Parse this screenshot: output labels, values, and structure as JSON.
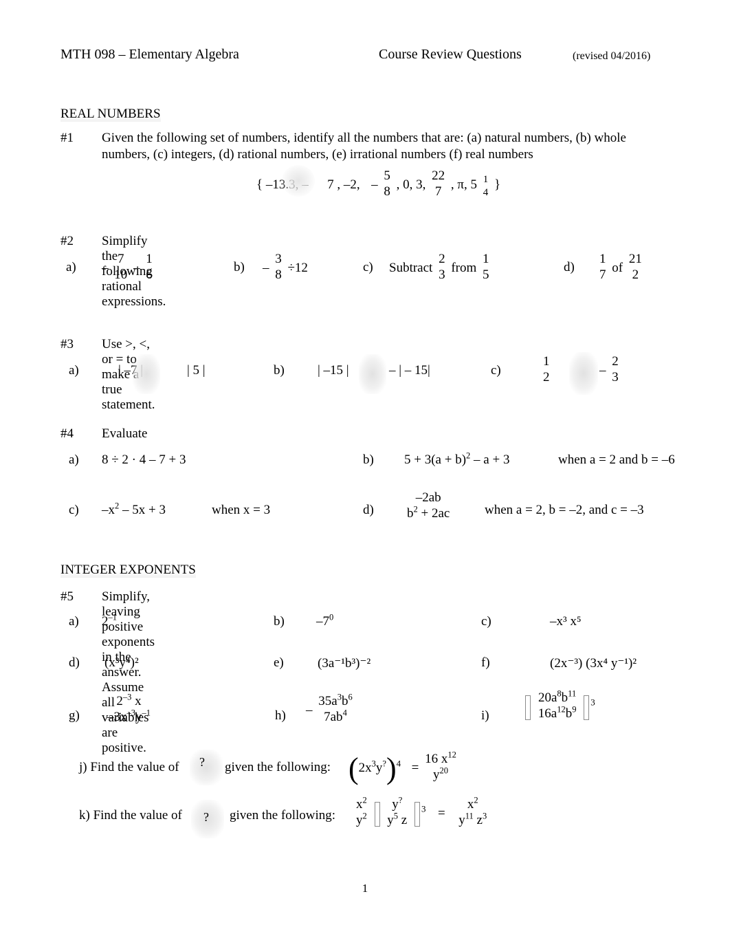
{
  "document": {
    "header": {
      "course": "MTH 098 – Elementary Algebra",
      "title": "Course Review Questions",
      "revised": "(revised 04/2016)"
    },
    "footer": {
      "page_number": "1"
    }
  },
  "sections": [
    {
      "id": "real-numbers",
      "heading": "REAL NUMBERS"
    },
    {
      "id": "integer-exponents",
      "heading": "INTEGER EXPONENTS"
    }
  ],
  "problems": {
    "p1": {
      "number": "#1",
      "text_line1": "Given the following set of numbers, identify all the numbers that are:  (a)  natural numbers, (b) whole",
      "text_line2": "numbers, (c) integers, (d) rational numbers, (e) irrational numbers (f) real numbers",
      "set": {
        "open": "{",
        "close": "}",
        "items": [
          "–13.3,",
          "–",
          "7 ,",
          "–2,",
          "–"
        ],
        "frac1_num": "5",
        "frac1_den": "8",
        "mid": ", 0, 3,",
        "frac2_num": "22",
        "frac2_den": "7",
        "tail": ",  π, 5",
        "mixed_num": "1",
        "mixed_den": "4"
      }
    },
    "p2": {
      "number": "#2",
      "text": "Simplify the following rational expressions.",
      "parts": {
        "a": {
          "label": "a)",
          "sign": "–",
          "f1_num": "7",
          "f1_den": "10",
          "op": "–",
          "f2_num": "1",
          "f2_den": "6"
        },
        "b": {
          "label": "b)",
          "sign": "–",
          "f1_num": "3",
          "f1_den": "8",
          "tail": "÷12"
        },
        "c": {
          "label": "c)",
          "word1": "Subtract",
          "f1_num": "2",
          "f1_den": "3",
          "word2": "from",
          "f2_num": "1",
          "f2_den": "5"
        },
        "d": {
          "label": "d)",
          "f1_num": "1",
          "f1_den": "7",
          "word": "of",
          "f2_num": "21",
          "f2_den": "2"
        }
      }
    },
    "p3": {
      "number": "#3",
      "text": "Use   >, <, or = to make a true statement.",
      "parts": {
        "a": {
          "label": "a)",
          "left": "| –7 |",
          "right": "| 5 |"
        },
        "b": {
          "label": "b)",
          "left": "| –15 |",
          "right": "– | – 15|"
        },
        "c": {
          "label": "c)",
          "f1_num": "1",
          "f1_den": "2",
          "sign": "–",
          "f2_num": "2",
          "f2_den": "3"
        }
      }
    },
    "p4": {
      "number": "#4",
      "text": "Evaluate",
      "parts": {
        "a": {
          "label": "a)",
          "expr": "8 ÷ 2 · 4  – 7 + 3"
        },
        "b": {
          "label": "b)",
          "expr_pre": "5 + 3(a + b)",
          "expr_sup": "2",
          "expr_post": " – a + 3",
          "cond": "when a = 2 and b = –6"
        },
        "c": {
          "label": "c)",
          "expr_pre": "–x",
          "expr_sup": "2",
          "expr_post": " – 5x + 3",
          "cond": "when x = 3"
        },
        "d": {
          "label": "d)",
          "num": "–2ab",
          "den_pre": "b",
          "den_sup": "2",
          "den_post": " + 2ac",
          "cond": "when a = 2, b = –2, and c = –3"
        }
      }
    },
    "p5": {
      "number": "#5",
      "text": "Simplify, leaving positive exponents in the answer. Assume all variables are positive.",
      "parts": {
        "a": {
          "label": "a)",
          "base": "2",
          "sup": "–1"
        },
        "b": {
          "label": "b)",
          "base": "–7",
          "sup": "0"
        },
        "c": {
          "label": "c)",
          "expr": "–x³ x⁵"
        },
        "d": {
          "label": "d)",
          "expr": "(x³y⁴)²"
        },
        "e": {
          "label": "e)",
          "expr": "(3a⁻¹b³)⁻²"
        },
        "f": {
          "label": "f)",
          "expr": "(2x⁻³) (3x⁴ y⁻¹)²"
        },
        "g": {
          "label": "g)",
          "num_pre": "2",
          "num_sup": "–3",
          "num_post": " x",
          "den_pre": "–3x",
          "den_sup1": "–3",
          "den_mid": "y",
          "den_sup2": "–1"
        },
        "h": {
          "label": "h)",
          "sign": "–",
          "num_pre": "35a",
          "num_sup1": "3",
          "num_mid": "b",
          "num_sup2": "6",
          "den_pre": "7ab",
          "den_sup": "4"
        },
        "i": {
          "label": "i)",
          "num_pre": "20a",
          "num_sup1": "8",
          "num_mid": "b",
          "num_sup2": "11",
          "den_pre": "16a",
          "den_sup1": "12",
          "den_mid": "b",
          "den_sup2": "9",
          "outer_sup": "3"
        },
        "j": {
          "label": "j) Find the value of",
          "unknown": "?",
          "given": "given the following:",
          "lhs_pre": "2x",
          "lhs_sup1": "3",
          "lhs_mid": "y",
          "lhs_sup2": "?",
          "lhs_outer_sup": "4",
          "eq": "=",
          "rhs_num_pre": "16 x",
          "rhs_num_sup": "12",
          "rhs_den_pre": "y",
          "rhs_den_sup": "20"
        },
        "k": {
          "label": "k) Find the value of",
          "unknown": "?",
          "given": "given the following:",
          "f1_num_pre": "x",
          "f1_num_sup": "2",
          "f1_den_pre": "y",
          "f1_den_sup": "2",
          "f2_num_pre": "y",
          "f2_num_sup": "?",
          "f2_den_pre": "y",
          "f2_den_sup": "5",
          "f2_den_post": " z",
          "outer_sup": "3",
          "eq": "=",
          "rhs_num_pre": "x",
          "rhs_num_sup": "2",
          "rhs_den_pre": "y",
          "rhs_den_sup1": "11",
          "rhs_den_mid": " z",
          "rhs_den_sup2": "3"
        }
      }
    }
  }
}
